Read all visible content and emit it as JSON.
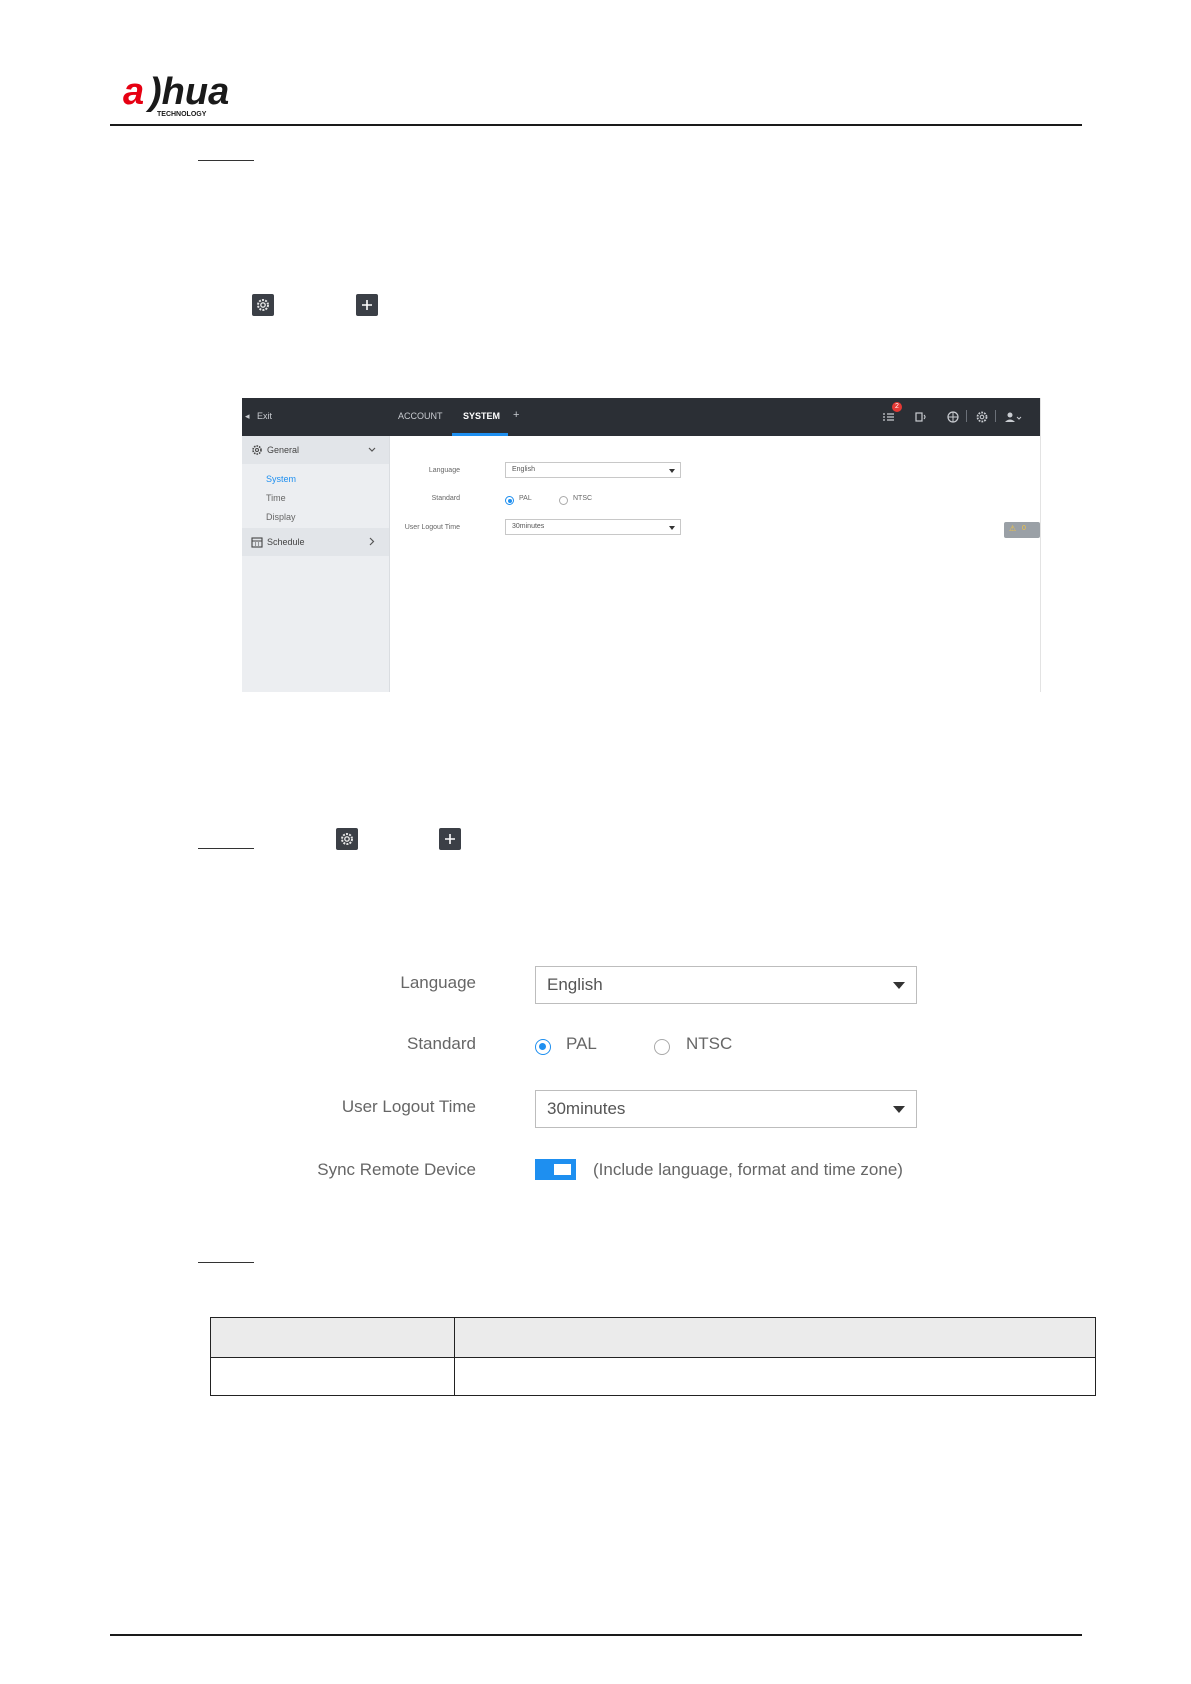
{
  "brand": {
    "logo_text": "alhua",
    "logo_subtext": "TECHNOLOGY",
    "logo_color": "#e60012"
  },
  "icons": {
    "settings_icon": "gear-icon",
    "add_icon": "plus-icon"
  },
  "screenshot": {
    "topbar": {
      "exit_label": "Exit",
      "tabs": [
        "ACCOUNT",
        "SYSTEM",
        "+"
      ],
      "active_tab": "SYSTEM",
      "notification_count": "2",
      "alarm_count": "0"
    },
    "sidebar": {
      "general_label": "General",
      "general_items": [
        "System",
        "Time",
        "Display"
      ],
      "active_item": "System",
      "schedule_label": "Schedule"
    },
    "form": {
      "language_label": "Language",
      "language_value": "English",
      "standard_label": "Standard",
      "standard_options": [
        "PAL",
        "NTSC"
      ],
      "standard_selected": "PAL",
      "logout_label": "User Logout Time",
      "logout_value": "30minutes"
    }
  },
  "settings_form": {
    "language_label": "Language",
    "language_value": "English",
    "standard_label": "Standard",
    "standard_options": [
      "PAL",
      "NTSC"
    ],
    "standard_selected": "PAL",
    "logout_label": "User Logout Time",
    "logout_value": "30minutes",
    "sync_label": "Sync Remote Device",
    "sync_enabled": true,
    "sync_hint": "(Include language, format and time zone)"
  },
  "colors": {
    "accent": "#1e8ff0",
    "topbar_bg": "#2b2f35",
    "sidebar_bg": "#eceef1"
  }
}
